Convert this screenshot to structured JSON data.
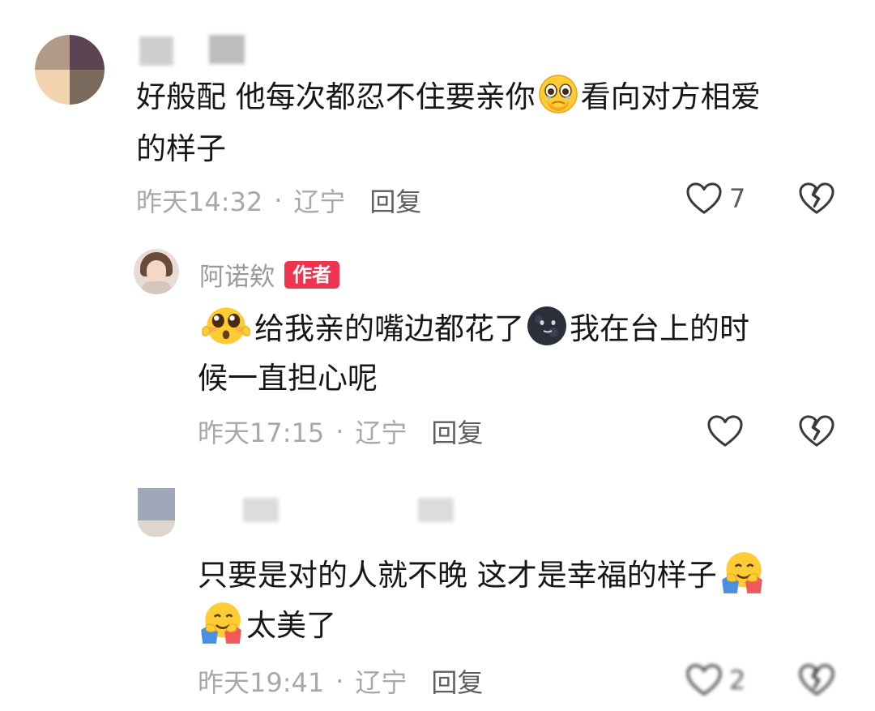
{
  "comments": [
    {
      "text_line1_a": "好般配  他每次都忍不住要亲你",
      "text_line1_b": "看向对方相爱",
      "text_line2": "的样子",
      "time": "昨天14:32",
      "region": "辽宁",
      "reply": "回复",
      "likes": "7"
    },
    {
      "author": "阿诺欸",
      "badge": "作者",
      "text_line1_a": "给我亲的嘴边都花了",
      "text_line1_b": "我在台上的时",
      "text_line2": "候一直担心呢",
      "time": "昨天17:15",
      "region": "辽宁",
      "reply": "回复"
    },
    {
      "text_line1": "只要是对的人就不晚 这才是幸福的样子",
      "text_line2": "太美了",
      "time": "昨天19:41",
      "region": "辽宁",
      "reply": "回复",
      "likes": "2"
    }
  ],
  "separator": "·",
  "icons": {
    "like": "heart-outline-icon",
    "dislike": "broken-heart-icon",
    "emoji_pleading": "pleading-face-emoji",
    "emoji_hug": "hugging-face-emoji",
    "emoji_dark_moon": "new-moon-face-emoji",
    "emoji_holding_tears": "face-holding-back-tears-emoji"
  }
}
